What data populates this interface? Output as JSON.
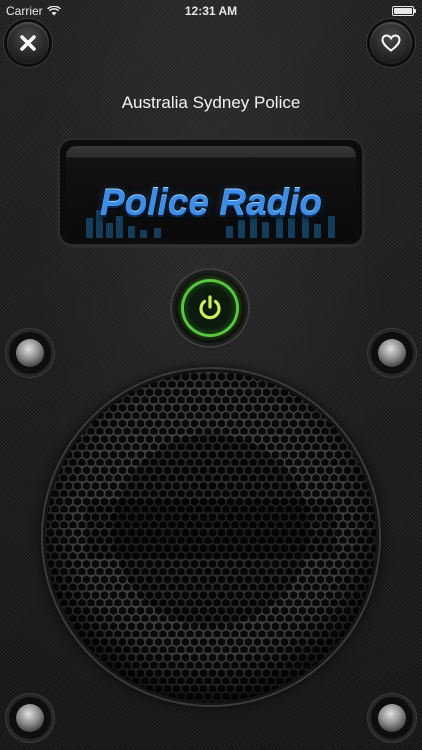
{
  "status_bar": {
    "carrier": "Carrier",
    "time": "12:31 AM"
  },
  "toolbar": {
    "close_icon": "close-icon",
    "favorite_icon": "heart-icon"
  },
  "station": {
    "name": "Australia Sydney Police"
  },
  "logo": {
    "text": "Police Radio",
    "color": "#3d8de6"
  },
  "power": {
    "icon": "power-icon",
    "color": "#58c53e"
  }
}
